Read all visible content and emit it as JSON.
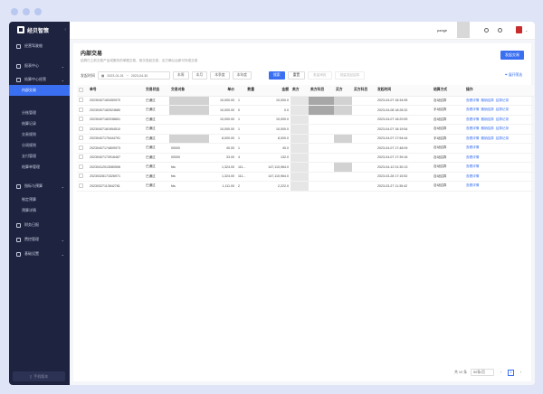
{
  "window": {
    "dots": [
      "dot1",
      "dot2",
      "dot3"
    ]
  },
  "sidebar": {
    "logo": "经贝智策",
    "items": [
      {
        "label": "经营驾驶舱",
        "icon": "dashboard-icon",
        "active": false,
        "sub": false
      },
      {
        "label": "报表中心",
        "icon": "report-icon",
        "active": false,
        "sub": false,
        "caret": true
      },
      {
        "label": "结算中心经营",
        "icon": "settle-icon",
        "active": false,
        "sub": false,
        "caret": true
      },
      {
        "label": "内部交易",
        "icon": "",
        "active": true,
        "sub": true
      },
      {
        "label": "分账管理",
        "icon": "",
        "active": false,
        "sub": true
      },
      {
        "label": "结算记录",
        "icon": "",
        "active": false,
        "sub": true
      },
      {
        "label": "交易规则",
        "icon": "",
        "active": false,
        "sub": true
      },
      {
        "label": "分润规则",
        "icon": "",
        "active": false,
        "sub": true
      },
      {
        "label": "支付管理",
        "icon": "",
        "active": false,
        "sub": true
      },
      {
        "label": "结算单管理",
        "icon": "",
        "active": false,
        "sub": true
      },
      {
        "label": "指标与预算",
        "icon": "target-icon",
        "active": false,
        "sub": false,
        "caret": true
      },
      {
        "label": "制定预算",
        "icon": "",
        "active": false,
        "sub": true
      },
      {
        "label": "预算详情",
        "icon": "",
        "active": false,
        "sub": true
      },
      {
        "label": "财务日报",
        "icon": "daily-icon",
        "active": false,
        "sub": false
      },
      {
        "label": "费控管理",
        "icon": "cost-icon",
        "active": false,
        "sub": false,
        "caret": true
      },
      {
        "label": "基础设置",
        "icon": "settings-icon",
        "active": false,
        "sub": false,
        "caret": true
      }
    ],
    "footer": "手机版本"
  },
  "topbar": {
    "user": "pange"
  },
  "page": {
    "title": "内部交易",
    "desc": "结算已之前交易产品或服务的单据交易，首次发起交易，买方确认后即可完成交易",
    "new_button": "发起交易"
  },
  "filter": {
    "label": "发起时间",
    "date_start": "2023-01-01",
    "date_sep": "~",
    "date_end": "2023-04-30",
    "quick": [
      "本周",
      "本月",
      "本季度",
      "本年度"
    ],
    "search": "搜索",
    "reset": "重置",
    "batch_approve": "批量审批",
    "batch_settle": "批量发起结算",
    "expand": "展开筛选"
  },
  "table": {
    "headers": [
      "单号",
      "交易状态",
      "交易对象",
      "单价",
      "数量",
      "金额",
      "卖方",
      "卖方科目",
      "买方",
      "买方科目",
      "发起时间",
      "结算方式"
    ],
    "op_header": "操作",
    "rows": [
      {
        "no": "20230407183450970",
        "status": "已通过",
        "obj": "",
        "price": "10,000.00",
        "qty": "1",
        "amount": "10,000.0",
        "time": "2023-04-07 18:34:55",
        "mode": "自动结算",
        "ops": [
          "查看详情",
          "撤销结算",
          "结算记录"
        ]
      },
      {
        "no": "20230407182524680",
        "status": "已通过",
        "obj": "",
        "price": "10,000.00",
        "qty": "0",
        "amount": "0.0",
        "time": "2023-04-08 18:28:32",
        "mode": "手动结算",
        "ops": [
          "查看详情",
          "撤销结算",
          "结算记录"
        ]
      },
      {
        "no": "20230407182038651",
        "status": "已通过",
        "obj": "",
        "price": "10,000.00",
        "qty": "1",
        "amount": "10,000.0",
        "time": "2023-04-07 18:20:59",
        "mode": "自动结算",
        "ops": [
          "查看详情",
          "撤销结算",
          "结算记录"
        ]
      },
      {
        "no": "20230407181954510",
        "status": "已通过",
        "obj": "",
        "price": "10,000.00",
        "qty": "1",
        "amount": "10,000.0",
        "time": "2023-04-07 18:19:54",
        "mode": "自动结算",
        "ops": [
          "查看详情",
          "撤销结算",
          "结算记录"
        ]
      },
      {
        "no": "20230407175444791",
        "status": "已通过",
        "obj": "",
        "price": "8,000.00",
        "qty": "1",
        "amount": "8,000.0",
        "time": "2023-04-07 17:54:44",
        "mode": "手动结算",
        "ops": [
          "查看详情",
          "撤销结算",
          "结算记录"
        ]
      },
      {
        "no": "20230407174809973",
        "status": "已通过",
        "obj": "00000",
        "price": "40.00",
        "qty": "1",
        "amount": "40.0",
        "time": "2023-04-07 17:48:09",
        "mode": "自动结算",
        "ops": [
          "查看详情"
        ]
      },
      {
        "no": "20230407173916467",
        "status": "已通过",
        "obj": "00000",
        "price": "33.00",
        "qty": "4",
        "amount": "132.0",
        "time": "2023-04-07 17:39:16",
        "mode": "自动结算",
        "ops": [
          "查看详情"
        ]
      },
      {
        "no": "20230412013080596",
        "status": "已通过",
        "obj": "fds",
        "price": "1,324.00",
        "qty": "111...",
        "amount": "147,110,964.0",
        "time": "2023-04-12 01:30:13",
        "mode": "自动结算",
        "ops": [
          "查看详情"
        ]
      },
      {
        "no": "20230328171526971",
        "status": "已通过",
        "obj": "fds",
        "price": "1,324.00",
        "qty": "111...",
        "amount": "147,110,964.0",
        "time": "2023-03-28 17:15:52",
        "mode": "自动结算",
        "ops": [
          "查看详情"
        ]
      },
      {
        "no": "20230327113542781",
        "status": "已通过",
        "obj": "fds",
        "price": "1,111.00",
        "qty": "2",
        "amount": "2,222.0",
        "time": "2023-03-27 11:35:42",
        "mode": "自动结算",
        "ops": [
          "查看详情"
        ]
      }
    ]
  },
  "pager": {
    "total": "共 10 条",
    "size": "50条/页",
    "page": "1",
    "prev": "‹",
    "next": "›"
  }
}
